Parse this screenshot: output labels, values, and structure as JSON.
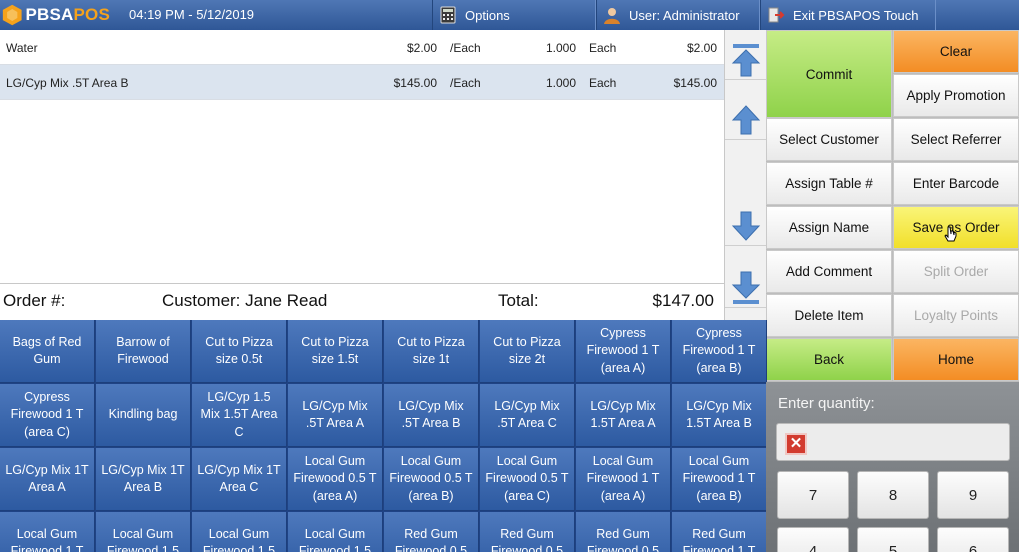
{
  "app": {
    "logo_prefix": "PBSA",
    "logo_suffix": "POS",
    "datetime": "04:19 PM - 5/12/2019",
    "options_label": "Options",
    "user_label": "User: Administrator",
    "exit_label": "Exit PBSAPOS Touch",
    "accent_color": "#f5a21b"
  },
  "order": {
    "items": [
      {
        "name": "Water",
        "price": "$2.00",
        "unit": "/Each",
        "qty": "1.000",
        "uom": "Each",
        "total": "$2.00"
      },
      {
        "name": "LG/Cyp Mix .5T Area B",
        "price": "$145.00",
        "unit": "/Each",
        "qty": "1.000",
        "uom": "Each",
        "total": "$145.00"
      }
    ],
    "order_label": "Order #:",
    "customer_label": "Customer: Jane Read",
    "total_label": "Total:",
    "total_value": "$147.00"
  },
  "actions": {
    "commit": "Commit",
    "clear": "Clear",
    "apply_promotion": "Apply Promotion",
    "select_customer": "Select Customer",
    "select_referrer": "Select Referrer",
    "assign_table": "Assign Table #",
    "enter_barcode": "Enter Barcode",
    "assign_name": "Assign Name",
    "save_as_order": "Save as Order",
    "add_comment": "Add Comment",
    "split_order": "Split Order",
    "delete_item": "Delete Item",
    "loyalty_points": "Loyalty Points",
    "back": "Back",
    "home": "Home"
  },
  "products": [
    "Bags of Red Gum",
    "Barrow of Firewood",
    "Cut to Pizza size 0.5t",
    "Cut to Pizza size 1.5t",
    "Cut to Pizza size 1t",
    "Cut to Pizza size 2t",
    "Cypress Firewood 1 T (area A)",
    "Cypress Firewood 1 T (area B)",
    "Cypress Firewood 1 T (area C)",
    "Kindling bag",
    "LG/Cyp 1.5 Mix 1.5T Area C",
    "LG/Cyp Mix .5T Area A",
    "LG/Cyp Mix .5T Area B",
    "LG/Cyp Mix .5T Area C",
    "LG/Cyp Mix 1.5T Area A",
    "LG/Cyp Mix 1.5T Area B",
    "LG/Cyp Mix 1T Area A",
    "LG/Cyp Mix 1T Area B",
    "LG/Cyp Mix 1T Area C",
    "Local Gum Firewood 0.5 T (area A)",
    "Local Gum Firewood 0.5 T (area B)",
    "Local Gum Firewood 0.5 T (area C)",
    "Local Gum Firewood 1 T (area A)",
    "Local Gum Firewood 1 T (area B)",
    "Local Gum Firewood 1 T",
    "Local Gum Firewood 1.5",
    "Local Gum Firewood 1.5",
    "Local Gum Firewood 1.5",
    "Red Gum Firewood 0.5",
    "Red Gum Firewood 0.5",
    "Red Gum Firewood 0.5",
    "Red Gum Firewood 1 T"
  ],
  "quantity": {
    "label": "Enter quantity:",
    "value": "",
    "clear_glyph": "✕",
    "keys": [
      "7",
      "8",
      "9",
      "4",
      "5",
      "6"
    ]
  }
}
